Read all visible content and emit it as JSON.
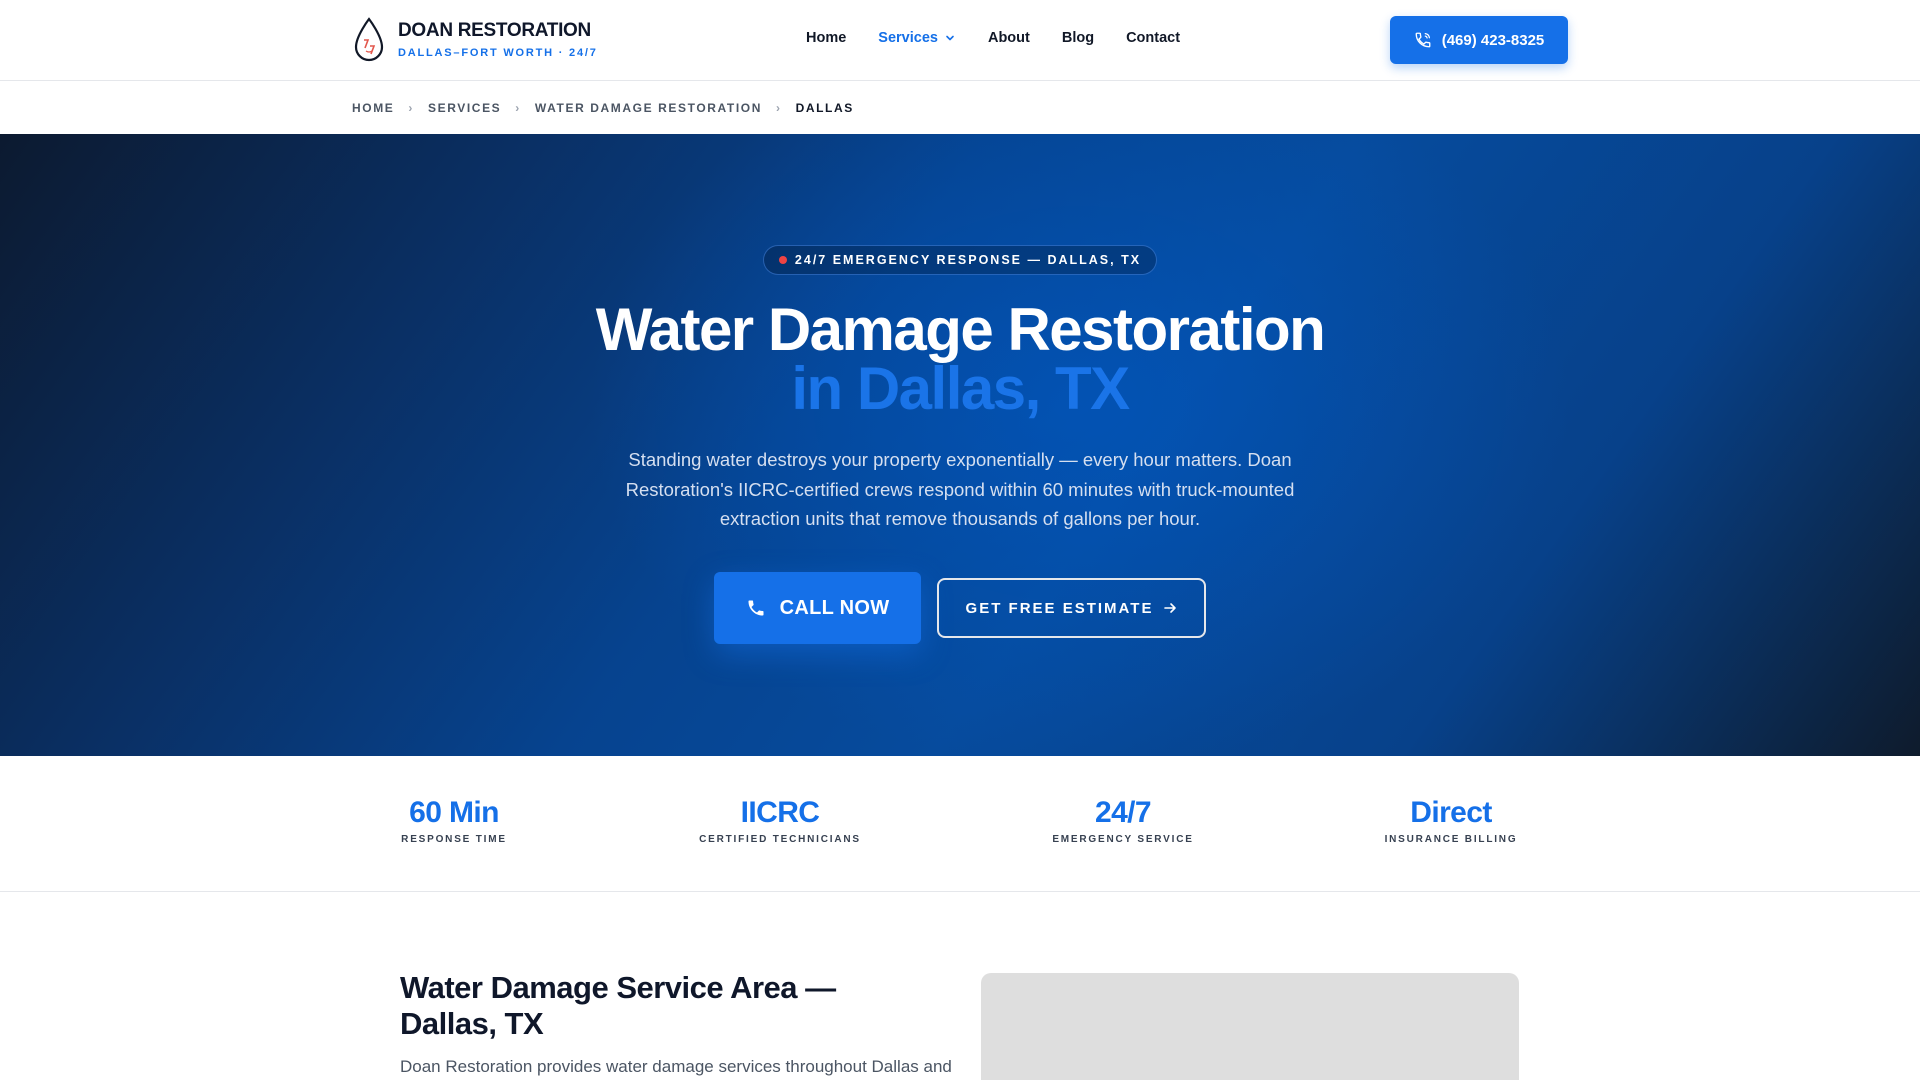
{
  "header": {
    "brand_name": "DOAN RESTORATION",
    "brand_tagline": "DALLAS–FORT WORTH · 24/7",
    "nav": [
      {
        "label": "Home",
        "active": false
      },
      {
        "label": "Services",
        "active": true,
        "has_dropdown": true
      },
      {
        "label": "About",
        "active": false
      },
      {
        "label": "Blog",
        "active": false
      },
      {
        "label": "Contact",
        "active": false
      }
    ],
    "phone_label": "(469) 423-8325"
  },
  "breadcrumb": [
    "HOME",
    "SERVICES",
    "WATER DAMAGE RESTORATION",
    "DALLAS"
  ],
  "hero": {
    "badge": "24/7 EMERGENCY RESPONSE — DALLAS, TX",
    "title_line1": "Water Damage Restoration",
    "title_line2": "in Dallas, TX",
    "subtitle": "Standing water destroys your property exponentially — every hour matters. Doan Restoration's IICRC-certified crews respond within 60 minutes with truck-mounted extraction units that remove thousands of gallons per hour.",
    "cta_call": "CALL NOW",
    "cta_estimate": "GET FREE ESTIMATE"
  },
  "stats": [
    {
      "value": "60 Min",
      "label": "RESPONSE TIME"
    },
    {
      "value": "IICRC",
      "label": "CERTIFIED TECHNICIANS"
    },
    {
      "value": "24/7",
      "label": "EMERGENCY SERVICE"
    },
    {
      "value": "Direct",
      "label": "INSURANCE BILLING"
    }
  ],
  "service_area": {
    "title": "Water Damage Service Area — Dallas, TX",
    "text": "Doan Restoration provides water damage services throughout Dallas and"
  },
  "colors": {
    "accent": "#1570e8",
    "hero_dark": "#0c1a30",
    "badge_dot": "#ef4444"
  },
  "icons": {
    "logo": "water-drop-logo-icon",
    "phone": "phone-icon",
    "chevron": "chevron-down-icon",
    "arrow": "arrow-right-icon"
  }
}
